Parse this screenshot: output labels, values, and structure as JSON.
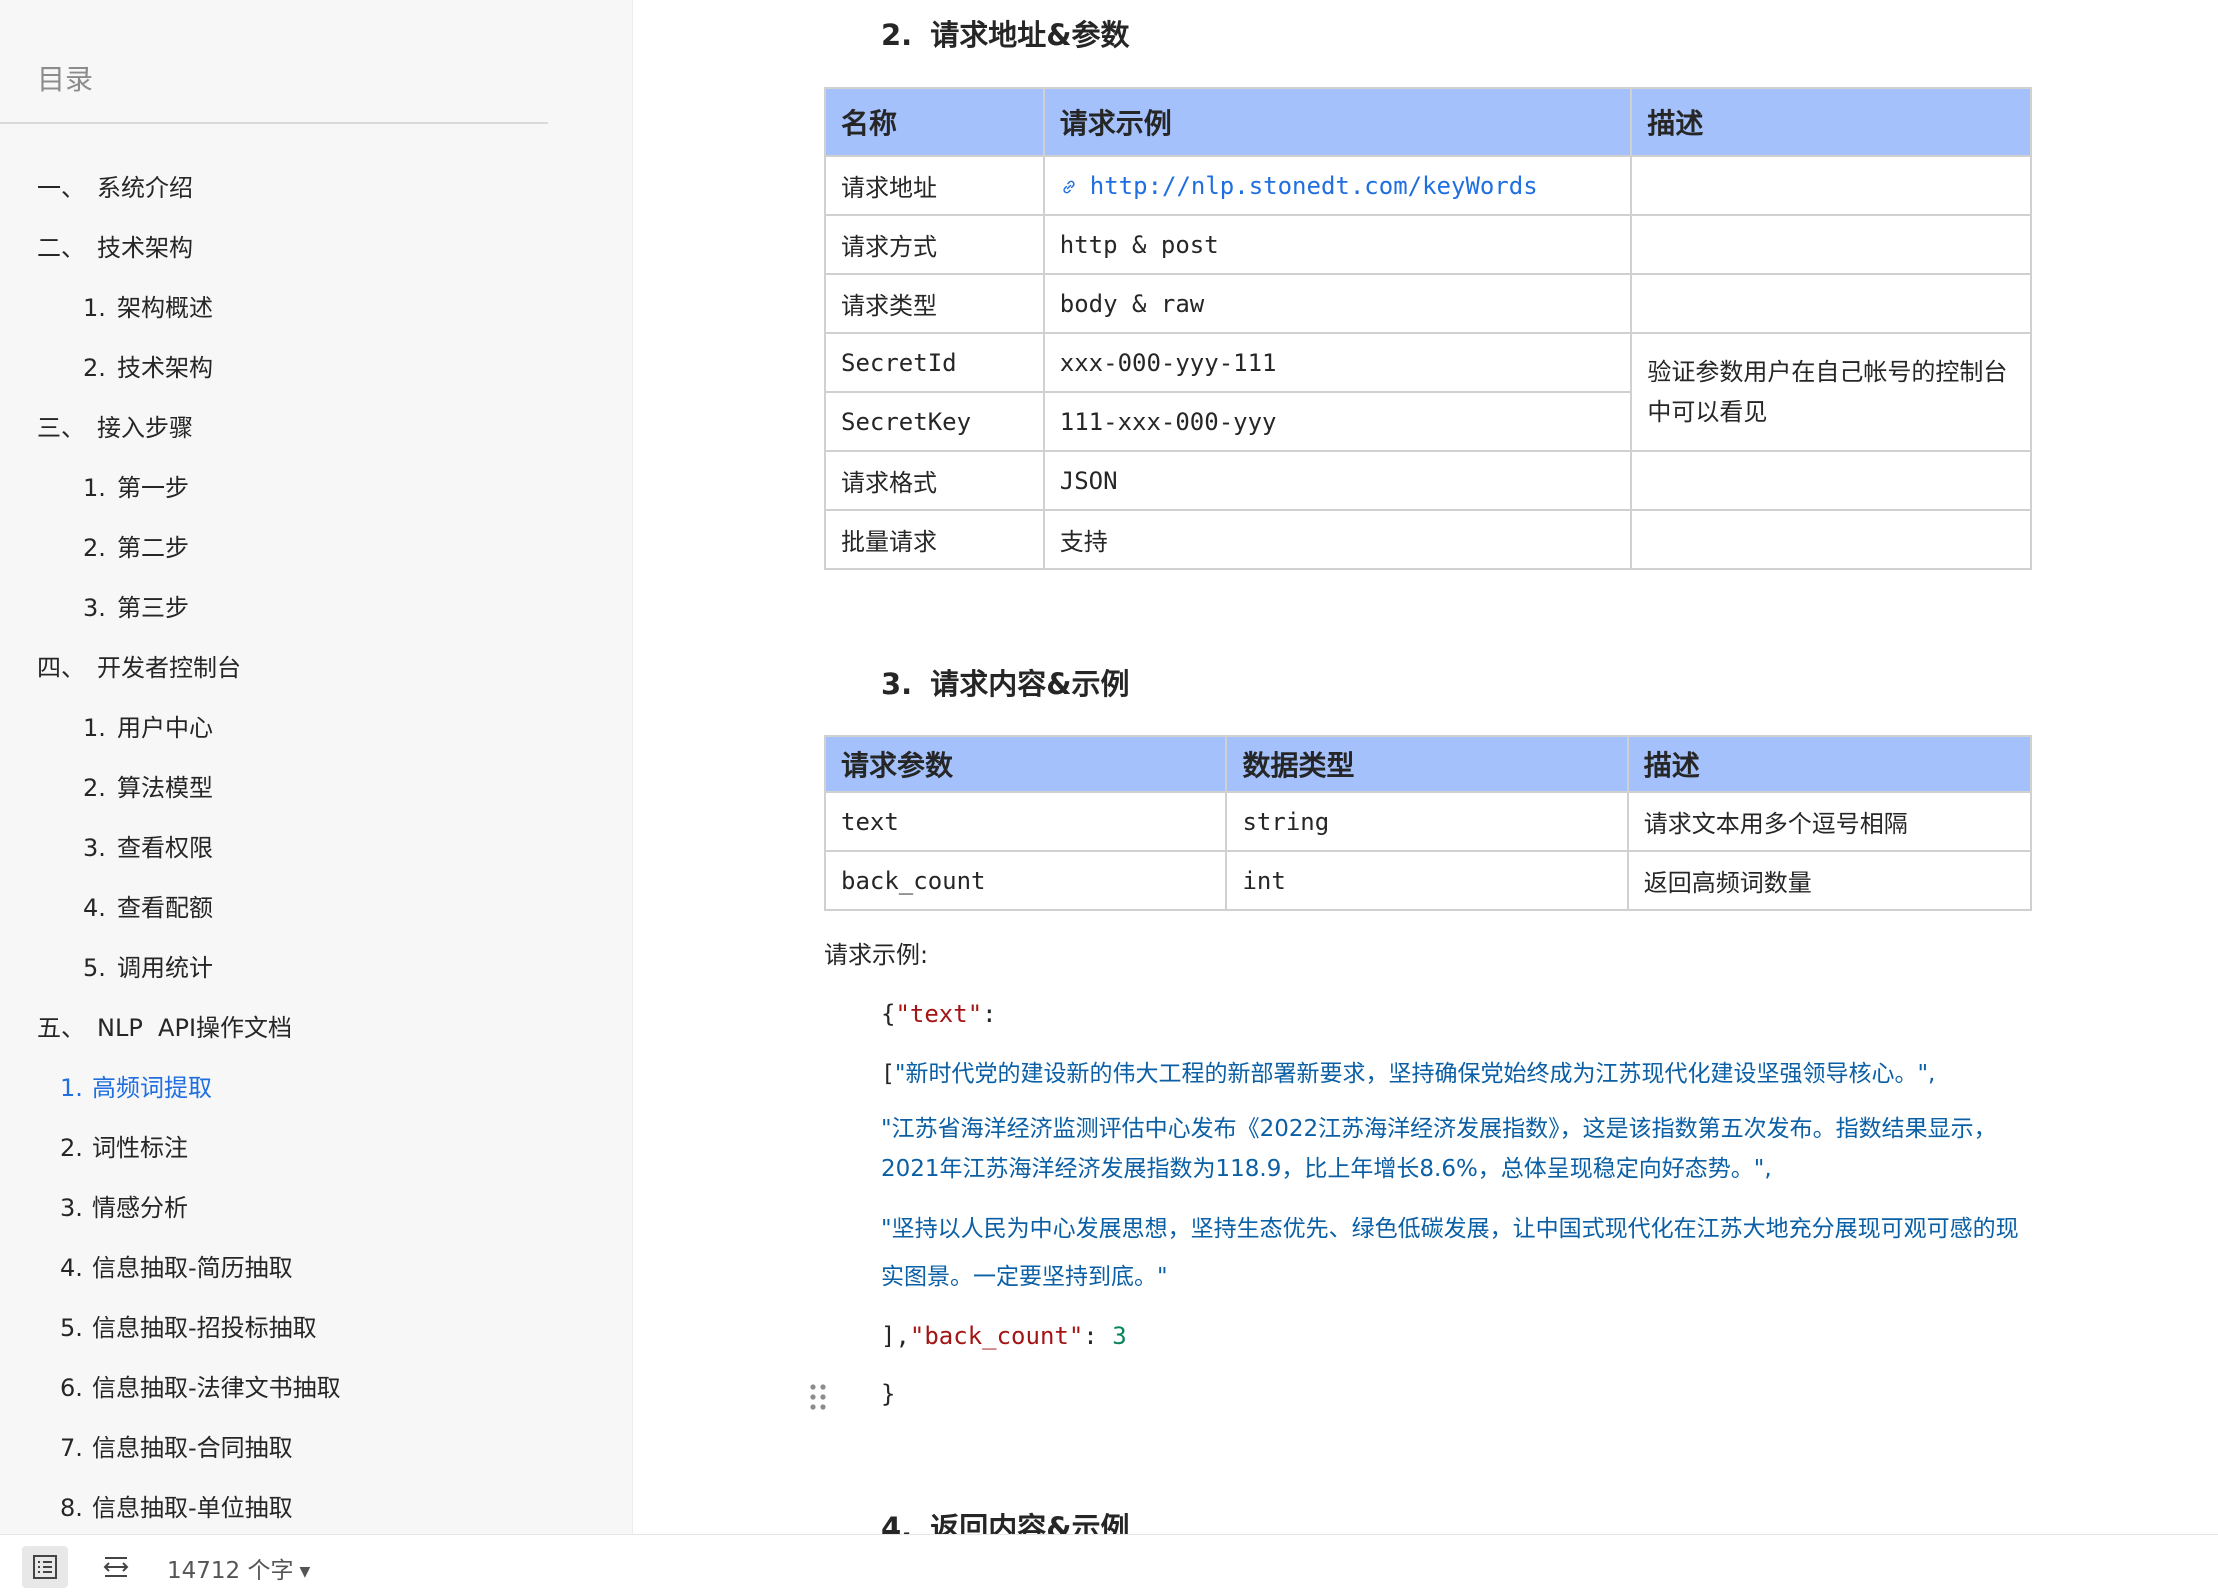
{
  "sidebar": {
    "title": "目录",
    "items": [
      {
        "num": "一、",
        "label": "系统介绍"
      },
      {
        "num": "二、",
        "label": "技术架构"
      },
      {
        "num": "1.",
        "label": "架构概述"
      },
      {
        "num": "2.",
        "label": "技术架构"
      },
      {
        "num": "三、",
        "label": "接入步骤"
      },
      {
        "num": "1.",
        "label": "第一步"
      },
      {
        "num": "2.",
        "label": "第二步"
      },
      {
        "num": "3.",
        "label": "第三步"
      },
      {
        "num": "四、",
        "label": "开发者控制台"
      },
      {
        "num": "1.",
        "label": "用户中心"
      },
      {
        "num": "2.",
        "label": "算法模型"
      },
      {
        "num": "3.",
        "label": "查看权限"
      },
      {
        "num": "4.",
        "label": "查看配额"
      },
      {
        "num": "5.",
        "label": "调用统计"
      },
      {
        "num": "五、",
        "label": "NLP  API操作文档"
      },
      {
        "num": "1.",
        "label": "高频词提取"
      },
      {
        "num": "2.",
        "label": "词性标注"
      },
      {
        "num": "3.",
        "label": "情感分析"
      },
      {
        "num": "4.",
        "label": "信息抽取-简历抽取"
      },
      {
        "num": "5.",
        "label": "信息抽取-招投标抽取"
      },
      {
        "num": "6.",
        "label": "信息抽取-法律文书抽取"
      },
      {
        "num": "7.",
        "label": "信息抽取-合同抽取"
      },
      {
        "num": "8.",
        "label": "信息抽取-单位抽取"
      }
    ]
  },
  "section2": {
    "num": "2.",
    "title": "请求地址&参数",
    "headers": [
      "名称",
      "请求示例",
      "描述"
    ],
    "rows": [
      {
        "name": "请求地址",
        "example": "http://nlp.stonedt.com/keyWords"
      },
      {
        "name": "请求方式",
        "example": "http & post"
      },
      {
        "name": "请求类型",
        "example": "body & raw"
      },
      {
        "name": "SecretId",
        "example": "xxx-000-yyy-111"
      },
      {
        "name": "SecretKey",
        "example": "111-xxx-000-yyy"
      },
      {
        "name": "请求格式",
        "example": "JSON"
      },
      {
        "name": "批量请求",
        "example": "支持"
      }
    ],
    "secret_desc": "验证参数用户在自己帐号的控制台中可以看见"
  },
  "section3": {
    "num": "3.",
    "title": "请求内容&示例",
    "headers": [
      "请求参数",
      "数据类型",
      "描述"
    ],
    "rows": [
      {
        "param": "text",
        "type": "string",
        "desc": "请求文本用多个逗号相隔"
      },
      {
        "param": "back_count",
        "type": "int",
        "desc": "返回高频词数量"
      }
    ],
    "example_label": "请求示例:",
    "code": {
      "open": "{",
      "text_key": "\"text\"",
      "colon": ":",
      "bracket_open": "[",
      "str1": "\"新时代党的建设新的伟大工程的新部署新要求，坚持确保党始终成为江苏现代化建设坚强领导核心。\",",
      "str2": "\"江苏省海洋经济监测评估中心发布《2022江苏海洋经济发展指数》，这是该指数第五次发布。指数结果显示，2021年江苏海洋经济发展指数为118.9，比上年增长8.6%，总体呈现稳定向好态势。\",",
      "str3": "\"坚持以人民为中心发展思想，坚持生态优先、绿色低碳发展，让中国式现代化在江苏大地充分展现可观可感的现实图景。一定要坚持到底。\"",
      "close_bracket": "],",
      "count_key": "\"back_count\"",
      "count_sep": ": ",
      "count_val": "3",
      "close": "}"
    }
  },
  "section4": {
    "num": "4.",
    "title": "返回内容&示例"
  },
  "statusbar": {
    "word_count": "14712 个字"
  }
}
